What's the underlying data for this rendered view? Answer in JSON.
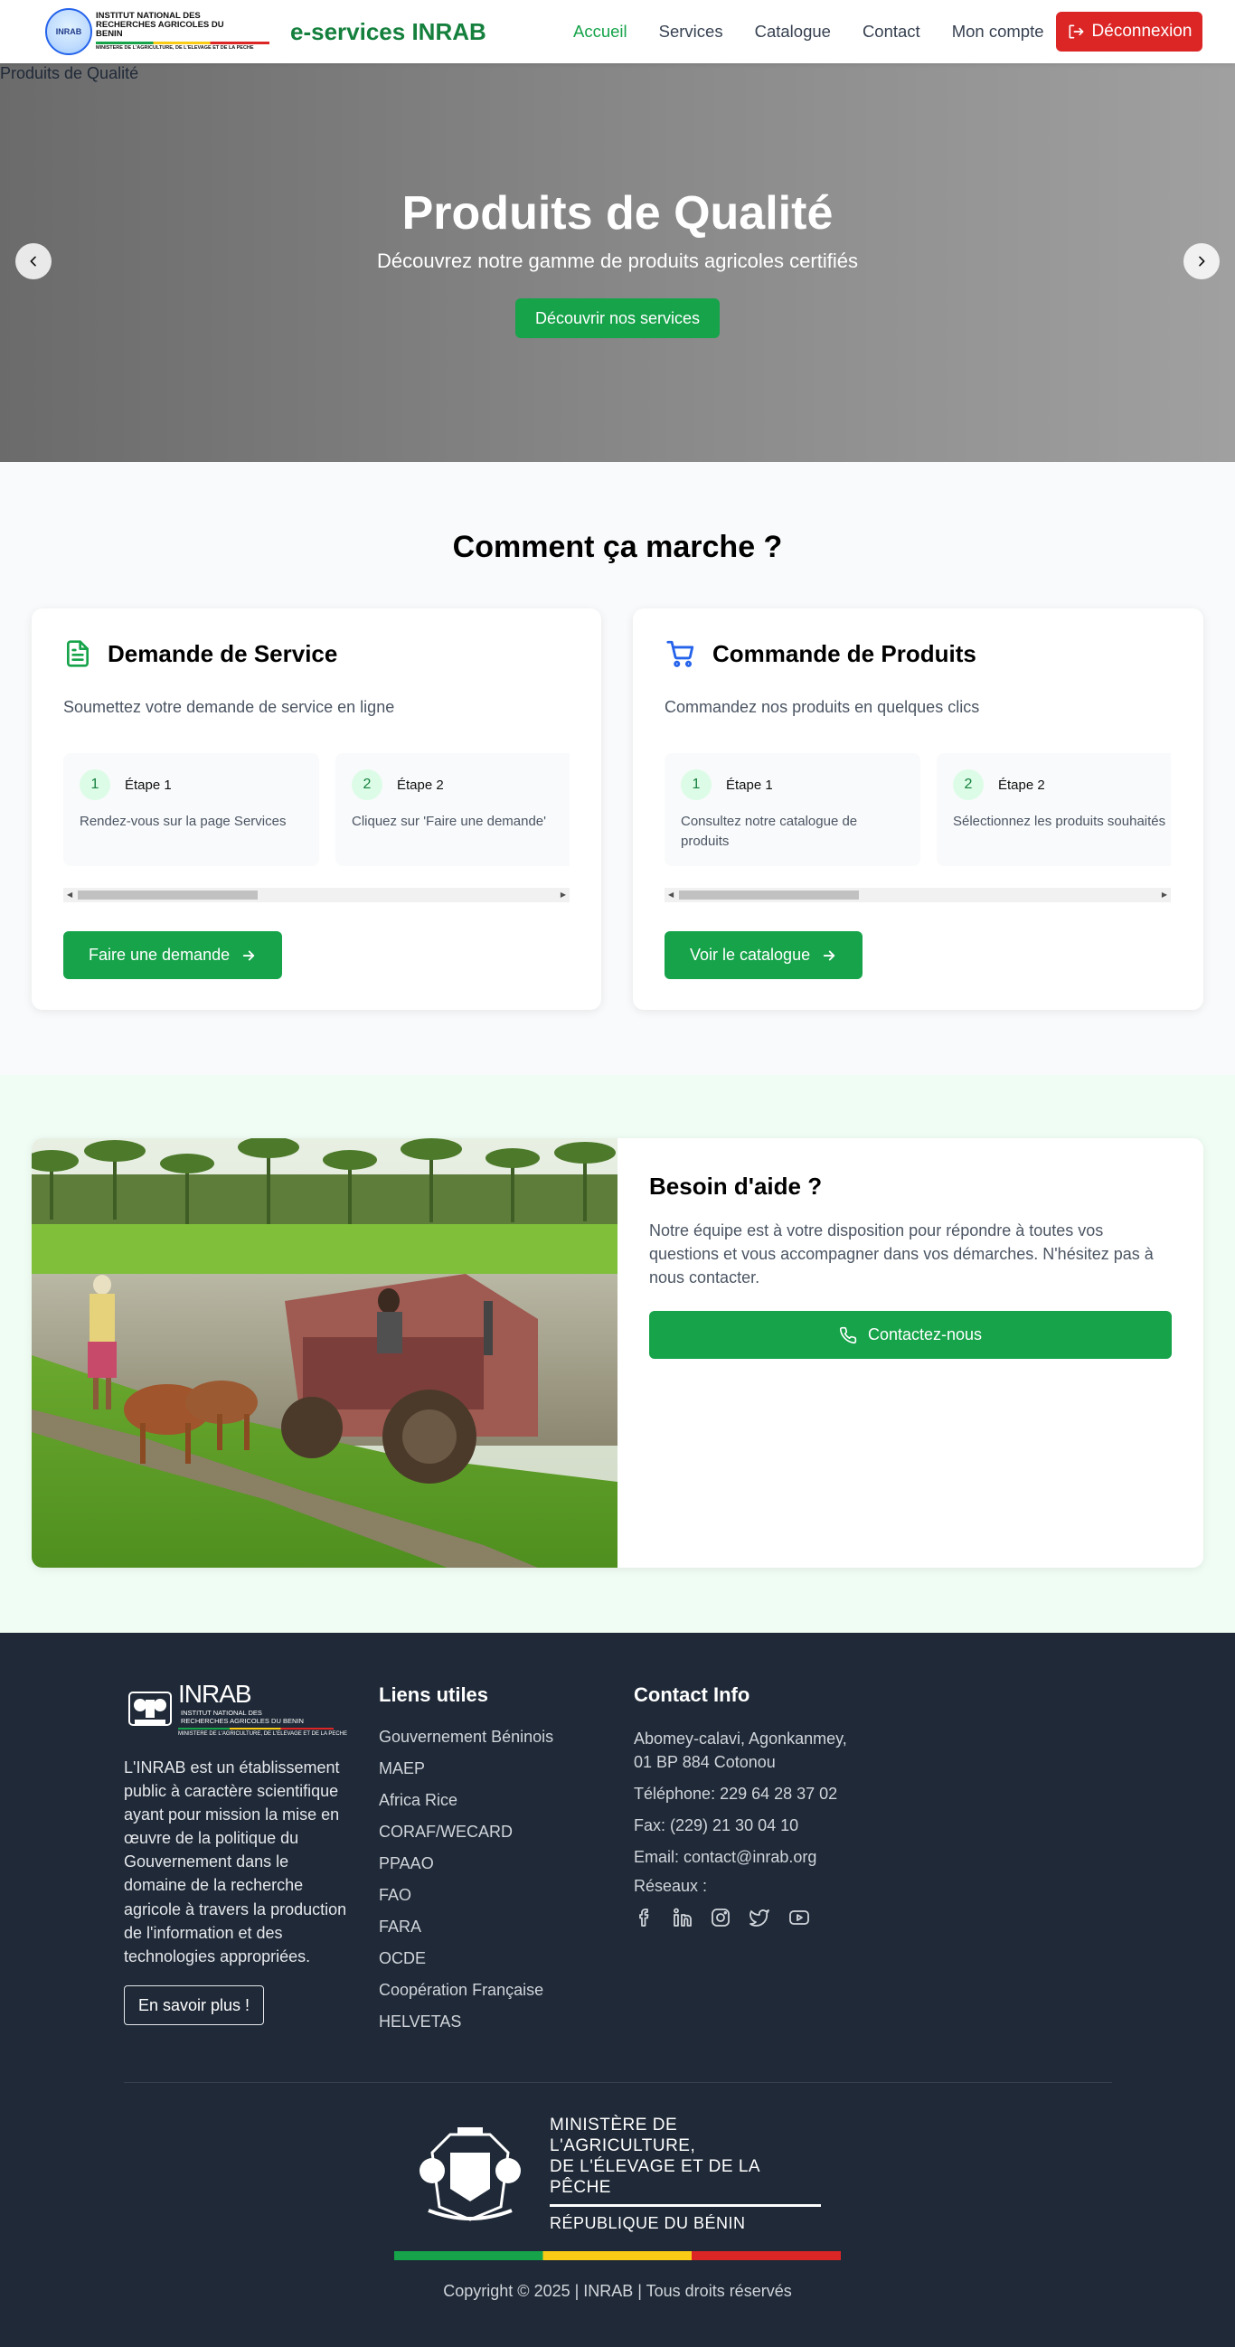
{
  "nav": {
    "logo": {
      "line1": "INSTITUT NATIONAL DES RECHERCHES AGRICOLES DU BENIN",
      "line2": "MINISTERE DE L'AGRICULTURE, DE L'ELEVAGE ET DE LA PECHE",
      "emblem": "INRAB"
    },
    "brand": "e-services INRAB",
    "links": [
      "Accueil",
      "Services",
      "Catalogue",
      "Contact",
      "Mon compte"
    ],
    "active_link": "Accueil",
    "logout_label": "Déconnexion"
  },
  "hero": {
    "image_alt": "Produits de Qualité",
    "title": "Produits de Qualité",
    "subtitle": "Découvrez notre gamme de produits agricoles certifiés",
    "button": "Découvrir nos services",
    "prev_icon": "chevron-left-icon",
    "next_icon": "chevron-right-icon"
  },
  "how": {
    "title": "Comment ça marche ?",
    "cards": [
      {
        "icon": "document-icon",
        "title": "Demande de Service",
        "description": "Soumettez votre demande de service en ligne",
        "steps": [
          {
            "num": "1",
            "label": "Étape 1",
            "text": "Rendez-vous sur la page Services"
          },
          {
            "num": "2",
            "label": "Étape 2",
            "text": "Cliquez sur 'Faire une demande'"
          }
        ],
        "button": "Faire une demande"
      },
      {
        "icon": "shopping-cart-icon",
        "title": "Commande de Produits",
        "description": "Commandez nos produits en quelques clics",
        "steps": [
          {
            "num": "1",
            "label": "Étape 1",
            "text": "Consultez notre catalogue de produits"
          },
          {
            "num": "2",
            "label": "Étape 2",
            "text": "Sélectionnez les produits souhaités"
          }
        ],
        "button": "Voir le catalogue"
      }
    ]
  },
  "help": {
    "title": "Besoin d'aide ?",
    "text": "Notre équipe est à votre disposition pour répondre à toutes vos questions et vous accompagner dans vos démarches. N'hésitez pas à nous contacter.",
    "button": "Contactez-nous"
  },
  "footer": {
    "logo": {
      "big": "INRAB",
      "small_line1": "INSTITUT NATIONAL DES",
      "small_line2": "RECHERCHES AGRICOLES DU BENIN",
      "ministry": "MINISTERE DE L'AGRICULTURE, DE L'ELEVAGE ET DE LA PECHE"
    },
    "description": "L'INRAB est un établissement public à caractère scientifique ayant pour mission la mise en œuvre de la politique du Gouvernement dans le domaine de la recherche agricole à travers la production de l'information et des technologies appropriées.",
    "more_button": "En savoir plus !",
    "links_title": "Liens utiles",
    "links": [
      "Gouvernement Béninois",
      "MAEP",
      "Africa Rice",
      "CORAF/WECARD",
      "PPAAO",
      "FAO",
      "FARA",
      "OCDE",
      "Coopération Française",
      "HELVETAS"
    ],
    "contact_title": "Contact Info",
    "address": "Abomey-calavi, Agonkanmey, 01 BP 884 Cotonou",
    "phone": "Téléphone: 229 64 28 37 02",
    "fax": "Fax: (229) 21 30 04 10",
    "email": "Email: contact@inrab.org",
    "socials_title": "Réseaux :",
    "socials": [
      "facebook-icon",
      "linkedin-icon",
      "instagram-icon",
      "twitter-icon",
      "youtube-icon"
    ],
    "ministry_line1": "MINISTÈRE DE L'AGRICULTURE,",
    "ministry_line2": "DE L'ÉLEVAGE ET DE LA PÊCHE",
    "ministry_line3": "RÉPUBLIQUE DU BÉNIN",
    "copyright": "Copyright © 2025 | INRAB | Tous droits réservés"
  }
}
